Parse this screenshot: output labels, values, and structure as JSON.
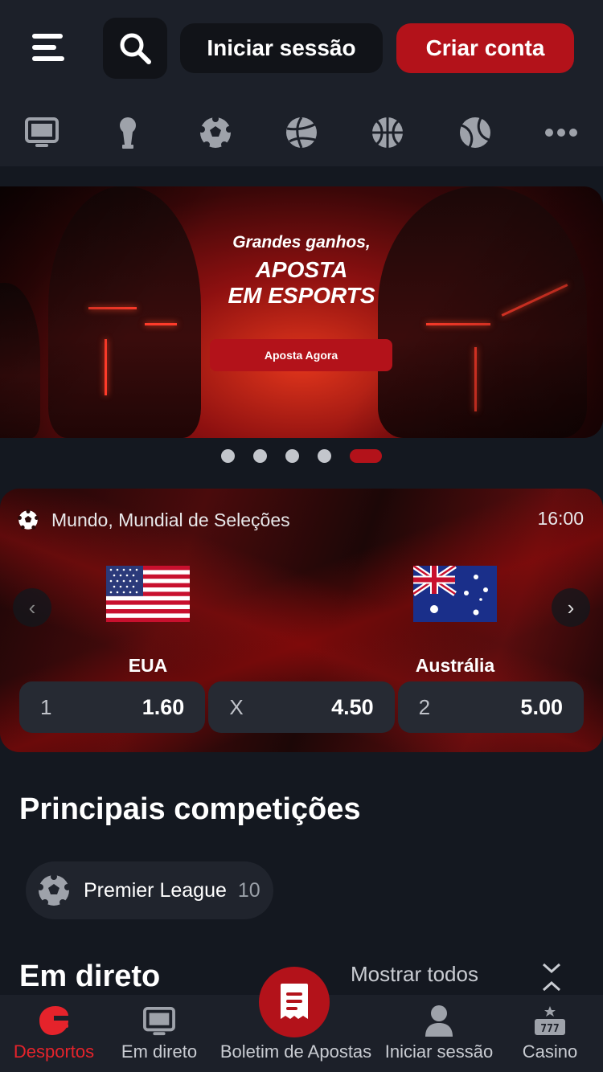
{
  "header": {
    "login_label": "Iniciar sessão",
    "signup_label": "Criar conta"
  },
  "sports_bar": [
    "live-tv-icon",
    "trophy-icon",
    "soccer-ball-icon",
    "volleyball-icon",
    "basketball-icon",
    "tennis-ball-icon",
    "more-icon"
  ],
  "banner": {
    "line1": "Grandes ganhos,",
    "line2": "APOSTA",
    "line3": "EM ESPORTS",
    "cta": "Aposta Agora",
    "slides": 5,
    "active_slide": 5
  },
  "featured_match": {
    "league": "Mundo, Mundial de Seleções",
    "time": "16:00",
    "home": {
      "name": "EUA",
      "flag": "usa-flag"
    },
    "away": {
      "name": "Austrália",
      "flag": "australia-flag"
    },
    "odds": [
      {
        "label": "1",
        "value": "1.60"
      },
      {
        "label": "X",
        "value": "4.50"
      },
      {
        "label": "2",
        "value": "5.00"
      }
    ]
  },
  "competitions": {
    "title": "Principais competições",
    "items": [
      {
        "name": "Premier League",
        "count": "10"
      }
    ]
  },
  "live": {
    "title": "Em direto",
    "show_all": "Mostrar todos"
  },
  "bottom_nav": {
    "items": [
      "Desportos",
      "Em direto",
      "Boletim de Apostas",
      "Iniciar sessão",
      "Casino"
    ],
    "active": "Desportos"
  },
  "colors": {
    "accent": "#b3121a",
    "active_nav": "#e5232b",
    "background": "#141820"
  }
}
